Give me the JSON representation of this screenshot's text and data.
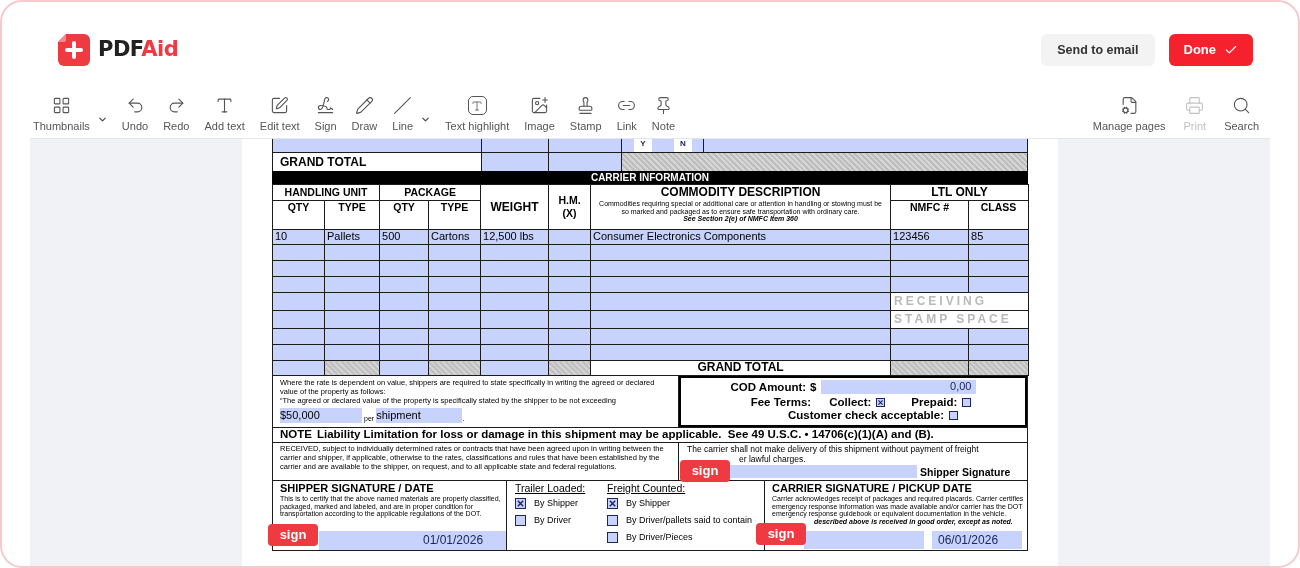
{
  "brand": {
    "name": "PDF",
    "accent": "Aid"
  },
  "actions": [
    {
      "label": "Send to email",
      "kind": "secondary"
    },
    {
      "label": "Done",
      "kind": "primary"
    }
  ],
  "toolbar": {
    "left": [
      {
        "label": "Thumbnails",
        "menu": true,
        "disabled": false
      },
      {
        "label": "Undo",
        "menu": false,
        "disabled": false
      },
      {
        "label": "Redo",
        "menu": false,
        "disabled": false
      },
      {
        "label": "Add text",
        "menu": false,
        "disabled": false
      },
      {
        "label": "Edit text",
        "menu": false,
        "disabled": false
      },
      {
        "label": "Sign",
        "menu": false,
        "disabled": false
      },
      {
        "label": "Draw",
        "menu": false,
        "disabled": false
      },
      {
        "label": "Line",
        "menu": true,
        "disabled": false
      },
      {
        "label": "Text highlight",
        "menu": false,
        "disabled": false
      },
      {
        "label": "Image",
        "menu": false,
        "disabled": false
      },
      {
        "label": "Stamp",
        "menu": false,
        "disabled": false
      },
      {
        "label": "Link",
        "menu": false,
        "disabled": false
      },
      {
        "label": "Note",
        "menu": false,
        "disabled": false
      }
    ],
    "right": [
      {
        "label": "Manage pages",
        "menu": false,
        "disabled": false
      },
      {
        "label": "Print",
        "menu": false,
        "disabled": true
      },
      {
        "label": "Search",
        "menu": false,
        "disabled": false
      }
    ]
  },
  "form": {
    "top_row": {
      "yes": "Y",
      "no": "N"
    },
    "summary_total": "GRAND TOTAL",
    "section_title": "CARRIER INFORMATION",
    "header": {
      "handling_unit": "HANDLING UNIT",
      "package": "PACKAGE",
      "weight": "WEIGHT",
      "hm": "H.M. (X)",
      "commodity": "COMMODITY DESCRIPTION",
      "commodity_note": "Commodities requiring special or additional care or attention in handling or stowing must be so marked and packaged as to ensure safe transportation with ordinary care.",
      "commodity_ref": "See Section 2(e) of NMFC Item 360",
      "ltl": "LTL ONLY",
      "sub": [
        "QTY",
        "TYPE",
        "QTY",
        "TYPE"
      ],
      "nmfc": "NMFC #",
      "class": "CLASS"
    },
    "rows": [
      {
        "hu_qty": "10",
        "hu_type": "Pallets",
        "pkg_qty": "500",
        "pkg_type": "Cartons",
        "weight": "12,500 lbs",
        "description": "Consumer Electronics Components",
        "nmfc": "123456",
        "class": "85"
      }
    ],
    "stamp": [
      "RECEIVING",
      "STAMP SPACE"
    ],
    "grand_total": "GRAND TOTAL",
    "declared_value": {
      "text": "Where the rate is dependent on value, shippers are required to state specifically in writing the agreed or declared value of the property as follows:",
      "quote": "“The agreed or declared value of the property is specifically stated by the shipper to be not exceeding",
      "amount": "$50,000",
      "per": "per",
      "unit": "shipment",
      "end": "."
    },
    "cod": {
      "label": "COD Amount:",
      "currency": "$",
      "amount": "0,00",
      "fee_terms": "Fee Terms:",
      "options": [
        {
          "label": "Collect:",
          "checked": true
        },
        {
          "label": "Prepaid:",
          "checked": false
        }
      ],
      "check_label": "Customer check acceptable:",
      "check_checked": false
    },
    "note": {
      "label": "NOTE",
      "text": "Liability Limitation for loss or damage in this shipment may be applicable.  See 49 U.S.C. • 14706(c)(1)(A) and (B)."
    },
    "received": "RECEIVED, subject to individually determined rates or contracts that have been agreed upon in writing between the carrier and shipper, if applicable, otherwise to the rates, classifications and rules that have been established by the carrier and are available to the shipper, on request, and to all applicable state and federal regulations.",
    "freight_notice": {
      "lines": [
        "The carrier shall not make delivery of this shipment without payment of freight",
        "er lawful charges."
      ],
      "sign": "sign",
      "signature_label": "Shipper Signature"
    },
    "shipper": {
      "title": "SHIPPER SIGNATURE / DATE",
      "text": "This is to certify that the above named materials are properly classified, packaged, marked and labeled, and are in proper condition for transportation according to the applicable regulations of the DOT.",
      "sign": "sign",
      "date": "01/01/2026"
    },
    "trailer": {
      "title": "Trailer Loaded:",
      "options": [
        {
          "label": "By Shipper",
          "checked": true
        },
        {
          "label": "By Driver",
          "checked": false
        }
      ]
    },
    "freight": {
      "title": "Freight Counted:",
      "options": [
        {
          "label": "By Shipper",
          "checked": true
        },
        {
          "label": "By Driver/pallets said to contain",
          "checked": false
        },
        {
          "label": "By Driver/Pieces",
          "checked": false
        }
      ]
    },
    "carrier": {
      "title": "CARRIER SIGNATURE / PICKUP DATE",
      "text": "Carrier acknowledges receipt of packages and required placards.  Carrier certifies emergency response information was made available and/or carrier has the DOT emergency response guidebook or equivalent documentation in the vehicle.",
      "received": "described above is received in good order, except as noted.",
      "sign": "sign",
      "date": "06/01/2026"
    }
  }
}
